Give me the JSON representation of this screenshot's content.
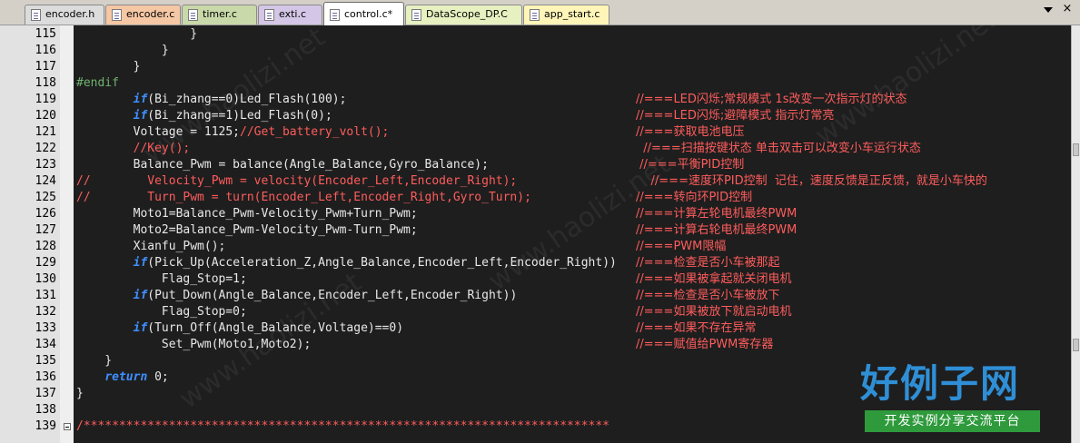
{
  "tabs": [
    {
      "label": "encoder.h",
      "color": "#dcdcdc"
    },
    {
      "label": "encoder.c",
      "color": "#f6c7a4"
    },
    {
      "label": "timer.c",
      "color": "#c9d9a9"
    },
    {
      "label": "exti.c",
      "color": "#d4c6e6"
    },
    {
      "label": "control.c*",
      "color": "#ffffff"
    },
    {
      "label": "DataScope_DP.C",
      "color": "#e6f0c0"
    },
    {
      "label": "app_start.c",
      "color": "#fff5b8"
    }
  ],
  "tab_bar": {
    "scroll_icon": "chevron-down-icon",
    "close_glyph": "×"
  },
  "editor": {
    "lines": [
      {
        "n": "115",
        "code": [
          {
            "t": "                }",
            "c": "plain"
          }
        ],
        "comment": ""
      },
      {
        "n": "116",
        "code": [
          {
            "t": "            }",
            "c": "plain"
          }
        ],
        "comment": ""
      },
      {
        "n": "117",
        "code": [
          {
            "t": "        }",
            "c": "plain"
          }
        ],
        "comment": ""
      },
      {
        "n": "118",
        "code": [
          {
            "t": "#endif",
            "c": "dir"
          }
        ],
        "comment": ""
      },
      {
        "n": "119",
        "code": [
          {
            "t": "        ",
            "c": "plain"
          },
          {
            "t": "if",
            "c": "kw"
          },
          {
            "t": "(Bi_zhang==0)Led_Flash(100);",
            "c": "plain"
          }
        ],
        "comment": "//===LED闪烁;常规模式 1s改变一次指示灯的状态"
      },
      {
        "n": "120",
        "code": [
          {
            "t": "        ",
            "c": "plain"
          },
          {
            "t": "if",
            "c": "kw"
          },
          {
            "t": "(Bi_zhang==1)Led_Flash(0);",
            "c": "plain"
          }
        ],
        "comment": "//===LED闪烁;避障模式 指示灯常亮"
      },
      {
        "n": "121",
        "code": [
          {
            "t": "        Voltage = 1125;",
            "c": "plain"
          },
          {
            "t": "//Get_battery_volt();",
            "c": "red"
          }
        ],
        "comment": "//===获取电池电压"
      },
      {
        "n": "122",
        "code": [
          {
            "t": "        //Key();",
            "c": "red"
          }
        ],
        "comment": "  //===扫描按键状态 单击双击可以改变小车运行状态"
      },
      {
        "n": "123",
        "code": [
          {
            "t": "        Balance_Pwm = balance(Angle_Balance,Gyro_Balance);",
            "c": "plain"
          }
        ],
        "comment": " //===平衡PID控制"
      },
      {
        "n": "124",
        "code": [
          {
            "t": "//        Velocity_Pwm = velocity(Encoder_Left,Encoder_Right);",
            "c": "red"
          }
        ],
        "comment": "    //===速度环PID控制  记住，速度反馈是正反馈，就是小车快的"
      },
      {
        "n": "125",
        "code": [
          {
            "t": "//        Turn_Pwm = turn(Encoder_Left,Encoder_Right,Gyro_Turn);",
            "c": "red"
          }
        ],
        "comment": "//===转向环PID控制"
      },
      {
        "n": "126",
        "code": [
          {
            "t": "        Moto1=Balance_Pwm-Velocity_Pwm+Turn_Pwm;",
            "c": "plain"
          }
        ],
        "comment": "//===计算左轮电机最终PWM"
      },
      {
        "n": "127",
        "code": [
          {
            "t": "        Moto2=Balance_Pwm-Velocity_Pwm-Turn_Pwm;",
            "c": "plain"
          }
        ],
        "comment": "//===计算右轮电机最终PWM"
      },
      {
        "n": "128",
        "code": [
          {
            "t": "        Xianfu_Pwm();",
            "c": "plain"
          }
        ],
        "comment": "//===PWM限幅"
      },
      {
        "n": "129",
        "code": [
          {
            "t": "        ",
            "c": "plain"
          },
          {
            "t": "if",
            "c": "kw"
          },
          {
            "t": "(Pick_Up(Acceleration_Z,Angle_Balance,Encoder_Left,Encoder_Right))",
            "c": "plain"
          }
        ],
        "comment": "//===检查是否小车被那起"
      },
      {
        "n": "130",
        "code": [
          {
            "t": "            Flag_Stop=1;",
            "c": "plain"
          }
        ],
        "comment": "//===如果被拿起就关闭电机"
      },
      {
        "n": "131",
        "code": [
          {
            "t": "        ",
            "c": "plain"
          },
          {
            "t": "if",
            "c": "kw"
          },
          {
            "t": "(Put_Down(Angle_Balance,Encoder_Left,Encoder_Right))",
            "c": "plain"
          }
        ],
        "comment": "//===检查是否小车被放下"
      },
      {
        "n": "132",
        "code": [
          {
            "t": "            Flag_Stop=0;",
            "c": "plain"
          }
        ],
        "comment": "//===如果被放下就启动电机"
      },
      {
        "n": "133",
        "code": [
          {
            "t": "        ",
            "c": "plain"
          },
          {
            "t": "if",
            "c": "kw"
          },
          {
            "t": "(Turn_Off(Angle_Balance,Voltage)==0)",
            "c": "plain"
          }
        ],
        "comment": "//===如果不存在异常"
      },
      {
        "n": "134",
        "code": [
          {
            "t": "            Set_Pwm(Moto1,Moto2);",
            "c": "plain"
          }
        ],
        "comment": "//===赋值给PWM寄存器"
      },
      {
        "n": "135",
        "code": [
          {
            "t": "    }",
            "c": "plain"
          }
        ],
        "comment": ""
      },
      {
        "n": "136",
        "code": [
          {
            "t": "    ",
            "c": "plain"
          },
          {
            "t": "return",
            "c": "kw"
          },
          {
            "t": " 0;",
            "c": "plain"
          }
        ],
        "comment": ""
      },
      {
        "n": "137",
        "code": [
          {
            "t": "}",
            "c": "plain"
          }
        ],
        "comment": ""
      },
      {
        "n": "138",
        "code": [
          {
            "t": "",
            "c": "plain"
          }
        ],
        "comment": ""
      },
      {
        "n": "139",
        "code": [
          {
            "t": "/**************************************************************************",
            "c": "red"
          }
        ],
        "comment": ""
      }
    ]
  },
  "watermark": {
    "title": "好例子网",
    "subtitle": "开发实例分享交流平台"
  },
  "colors": {
    "editor_bg": "#1e1e1e",
    "keyword": "#3f8fff",
    "comment": "#ff5c5c",
    "directive": "#6fb36f",
    "text": "#e8e8e8"
  }
}
